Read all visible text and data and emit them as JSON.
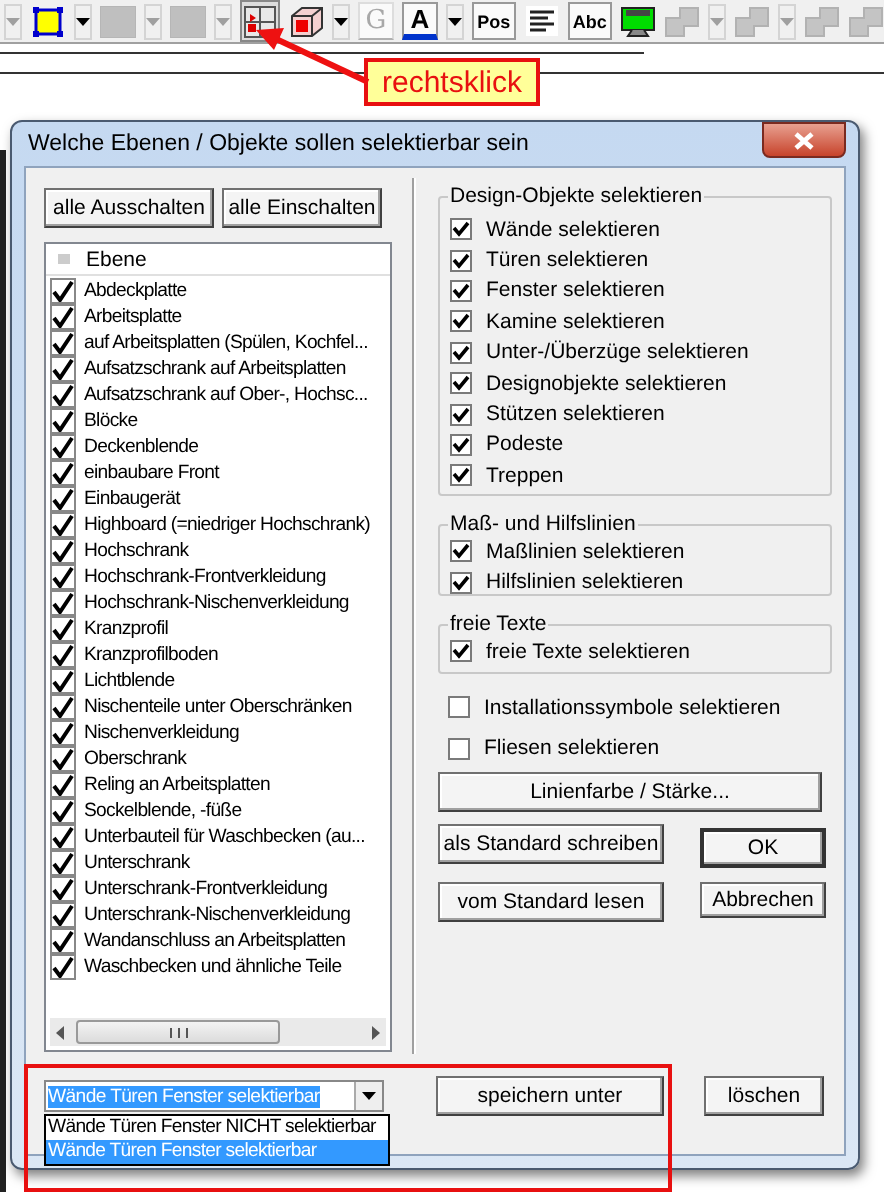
{
  "toolbar": [
    {
      "kind": "dropdown",
      "disabled": true
    },
    {
      "kind": "frame",
      "disabled": false
    },
    {
      "kind": "dropdown",
      "disabled": false
    },
    {
      "kind": "swatch",
      "disabled": true
    },
    {
      "kind": "dropdown",
      "disabled": true
    },
    {
      "kind": "swatch",
      "disabled": true
    },
    {
      "kind": "dropdown",
      "disabled": true
    },
    {
      "kind": "layers",
      "disabled": false
    },
    {
      "kind": "cube",
      "disabled": false
    },
    {
      "kind": "dropdown",
      "disabled": false
    },
    {
      "kind": "letter",
      "label": "G",
      "disabled": true
    },
    {
      "kind": "font-color",
      "label": "A",
      "disabled": false
    },
    {
      "kind": "dropdown",
      "disabled": false
    },
    {
      "kind": "text",
      "label": "Pos",
      "disabled": false
    },
    {
      "kind": "lines",
      "disabled": false
    },
    {
      "kind": "text",
      "label": "Abc",
      "disabled": false
    },
    {
      "kind": "monitor",
      "disabled": false
    },
    {
      "kind": "shape",
      "disabled": true
    },
    {
      "kind": "dropdown",
      "disabled": true
    },
    {
      "kind": "shape",
      "disabled": true
    },
    {
      "kind": "dropdown",
      "disabled": true
    },
    {
      "kind": "shape",
      "disabled": true
    },
    {
      "kind": "shape",
      "disabled": true
    }
  ],
  "callout": {
    "text": "rechtsklick"
  },
  "dialog": {
    "title": "Welche Ebenen / Objekte sollen selektierbar sein",
    "list_buttons": [
      "alle Ausschalten",
      "alle Einschalten"
    ],
    "layer_list": {
      "column": "Ebene",
      "items": [
        {
          "label": "Abdeckplatte",
          "checked": true
        },
        {
          "label": "Arbeitsplatte",
          "checked": true
        },
        {
          "label": "auf Arbeitsplatten (Spülen, Kochfel...",
          "checked": true
        },
        {
          "label": "Aufsatzschrank auf Arbeitsplatten",
          "checked": true
        },
        {
          "label": "Aufsatzschrank auf Ober-, Hochsc...",
          "checked": true
        },
        {
          "label": "Blöcke",
          "checked": true
        },
        {
          "label": "Deckenblende",
          "checked": true
        },
        {
          "label": "einbaubare Front",
          "checked": true
        },
        {
          "label": "Einbaugerät",
          "checked": true
        },
        {
          "label": "Highboard (=niedriger Hochschrank)",
          "checked": true
        },
        {
          "label": "Hochschrank",
          "checked": true
        },
        {
          "label": "Hochschrank-Frontverkleidung",
          "checked": true
        },
        {
          "label": "Hochschrank-Nischenverkleidung",
          "checked": true
        },
        {
          "label": "Kranzprofil",
          "checked": true
        },
        {
          "label": "Kranzprofilboden",
          "checked": true
        },
        {
          "label": "Lichtblende",
          "checked": true
        },
        {
          "label": "Nischenteile unter Oberschränken",
          "checked": true
        },
        {
          "label": "Nischenverkleidung",
          "checked": true
        },
        {
          "label": "Oberschrank",
          "checked": true
        },
        {
          "label": "Reling an Arbeitsplatten",
          "checked": true
        },
        {
          "label": "Sockelblende, -füße",
          "checked": true
        },
        {
          "label": "Unterbauteil für Waschbecken (au...",
          "checked": true
        },
        {
          "label": "Unterschrank",
          "checked": true
        },
        {
          "label": "Unterschrank-Frontverkleidung",
          "checked": true
        },
        {
          "label": "Unterschrank-Nischenverkleidung",
          "checked": true
        },
        {
          "label": "Wandanschluss an Arbeitsplatten",
          "checked": true
        },
        {
          "label": "Waschbecken und ähnliche Teile",
          "checked": true
        }
      ]
    },
    "groups": [
      {
        "title": "Design-Objekte selektieren",
        "items": [
          {
            "label": "Wände selektieren",
            "checked": true
          },
          {
            "label": "Türen selektieren",
            "checked": true
          },
          {
            "label": "Fenster selektieren",
            "checked": true
          },
          {
            "label": "Kamine selektieren",
            "checked": true
          },
          {
            "label": "Unter-/Überzüge selektieren",
            "checked": true
          },
          {
            "label": "Designobjekte selektieren",
            "checked": true
          },
          {
            "label": "Stützen selektieren",
            "checked": true
          },
          {
            "label": "Podeste",
            "checked": true
          },
          {
            "label": "Treppen",
            "checked": true
          }
        ]
      },
      {
        "title": "Maß- und Hilfslinien",
        "items": [
          {
            "label": "Maßlinien selektieren",
            "checked": true
          },
          {
            "label": "Hilfslinien selektieren",
            "checked": true
          }
        ]
      },
      {
        "title": "freie Texte",
        "items": [
          {
            "label": "freie Texte selektieren",
            "checked": true
          }
        ]
      }
    ],
    "options": [
      {
        "label": "Installationssymbole selektieren",
        "checked": false
      },
      {
        "label": "Fliesen selektieren",
        "checked": false
      }
    ],
    "line_button": "Linienfarbe / Stärke...",
    "standard_buttons": [
      "als Standard schreiben",
      "vom Standard lesen"
    ],
    "ok_button": "OK",
    "cancel_button": "Abbrechen",
    "preset": {
      "value": "Wände Türen Fenster selektierbar",
      "options": [
        {
          "label": "Wände Türen Fenster NICHT selektierbar",
          "selected": false
        },
        {
          "label": "Wände Türen Fenster selektierbar",
          "selected": true
        }
      ]
    },
    "save_button": "speichern unter",
    "delete_button": "löschen"
  }
}
